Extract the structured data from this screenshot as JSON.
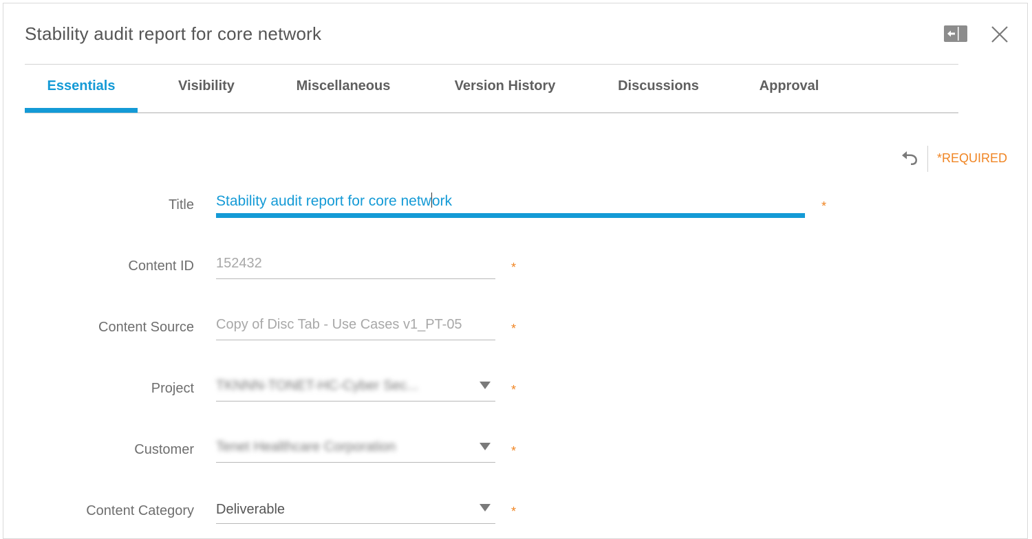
{
  "header": {
    "title": "Stability audit report for core network",
    "collapse_icon": "panel-collapse-icon",
    "close_icon": "close-icon"
  },
  "tabs": [
    {
      "label": "Essentials",
      "active": true
    },
    {
      "label": "Visibility",
      "active": false
    },
    {
      "label": "Miscellaneous",
      "active": false
    },
    {
      "label": "Version History",
      "active": false
    },
    {
      "label": "Discussions",
      "active": false
    },
    {
      "label": "Approval",
      "active": false
    }
  ],
  "toolbar": {
    "undo_icon": "undo-icon",
    "required_note": "*REQUIRED"
  },
  "form": {
    "title": {
      "label": "Title",
      "value_before_cursor": "Stability audit report for core netw",
      "value_after_cursor": "ork",
      "required": "*"
    },
    "content_id": {
      "label": "Content ID",
      "value": "152432",
      "required": "*"
    },
    "content_source": {
      "label": "Content Source",
      "value": "Copy of Disc Tab - Use Cases v1_PT-05",
      "required": "*"
    },
    "project": {
      "label": "Project",
      "value": "TKNNN-TONET-HC-Cyber Sec...",
      "required": "*"
    },
    "customer": {
      "label": "Customer",
      "value": "Tenet Healthcare Corporation",
      "required": "*"
    },
    "content_category": {
      "label": "Content Category",
      "value": "Deliverable",
      "required": "*"
    }
  },
  "colors": {
    "accent": "#149ad6",
    "required": "#f08523",
    "label": "#6e6e6e"
  }
}
